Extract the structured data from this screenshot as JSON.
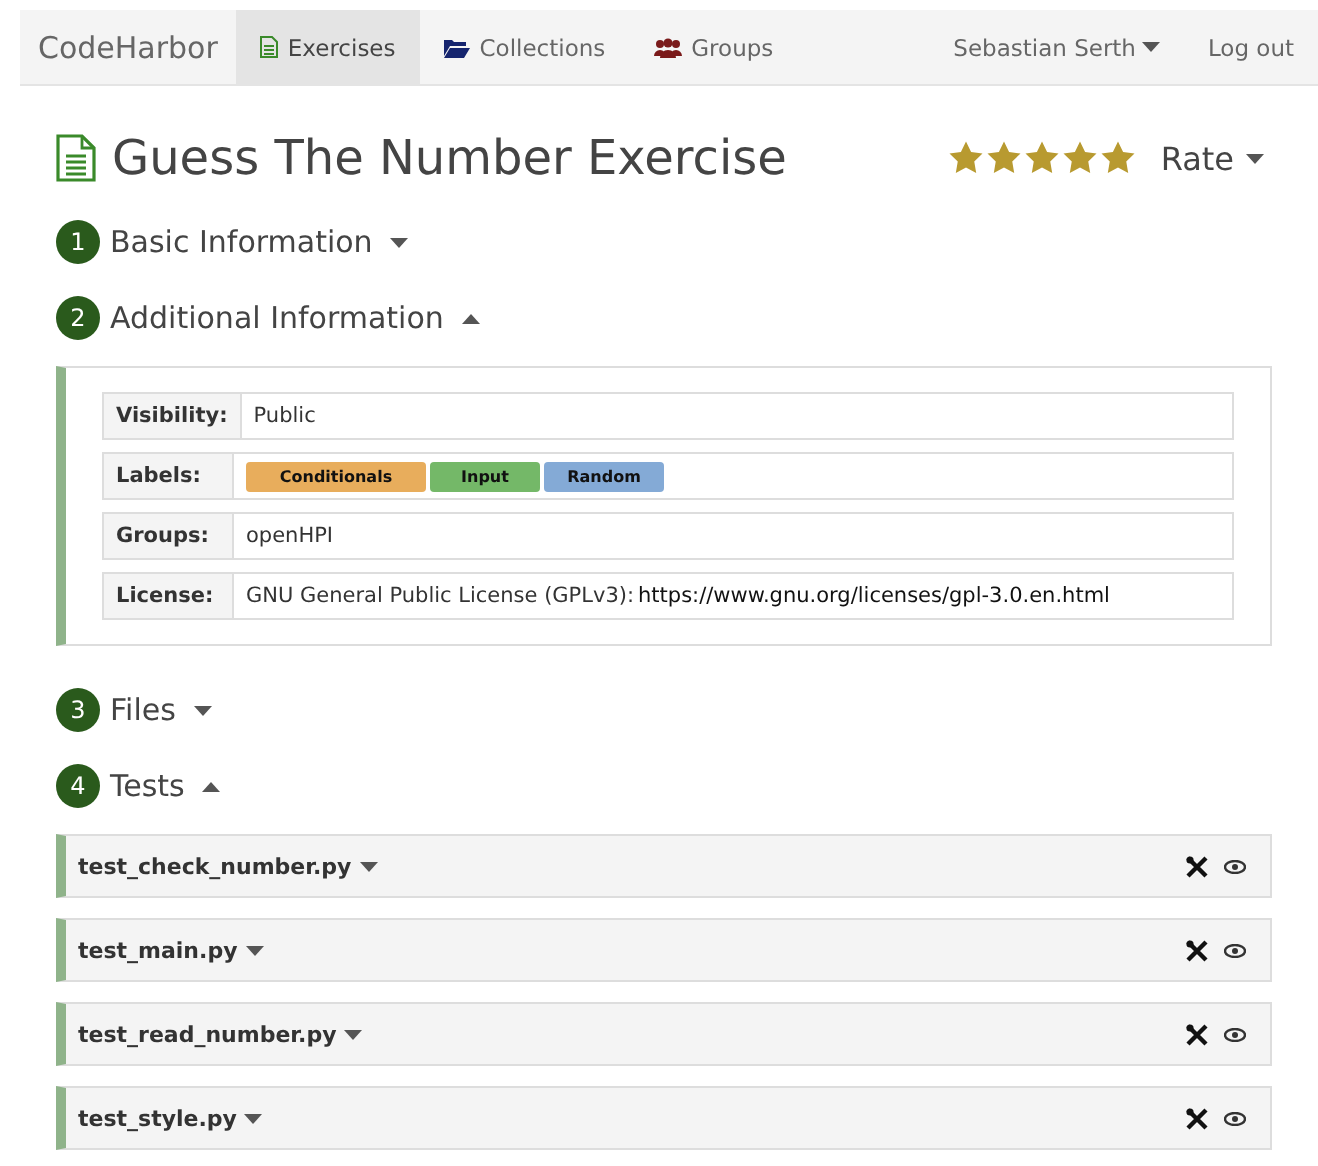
{
  "navbar": {
    "brand": "CodeHarbor",
    "items": [
      {
        "label": "Exercises",
        "selected": true
      },
      {
        "label": "Collections",
        "selected": false
      },
      {
        "label": "Groups",
        "selected": false
      }
    ],
    "user": "Sebastian Serth",
    "logout": "Log out"
  },
  "title": "Guess The Number Exercise",
  "stars": 5,
  "rate": "Rate",
  "sections": [
    {
      "number": "1",
      "title": "Basic Information",
      "expanded": false
    },
    {
      "number": "2",
      "title": "Additional Information",
      "expanded": true,
      "details": [
        {
          "label": "Visibility:",
          "value": "Public"
        },
        {
          "label": "Labels:",
          "tags": [
            {
              "text": "Conditionals",
              "color": "#e8ad5c"
            },
            {
              "text": "Input",
              "color": "#74b868"
            },
            {
              "text": "Random",
              "color": "#84aad6"
            }
          ]
        },
        {
          "label": "Groups:",
          "value": "openHPI"
        },
        {
          "label": "License:",
          "value": "GNU General Public License (GPLv3):",
          "link": "https://www.gnu.org/licenses/gpl-3.0.en.html"
        }
      ]
    },
    {
      "number": "3",
      "title": "Files",
      "expanded": false
    },
    {
      "number": "4",
      "title": "Tests",
      "expanded": true,
      "tests": [
        {
          "name": "test_check_number.py"
        },
        {
          "name": "test_main.py"
        },
        {
          "name": "test_read_number.py"
        },
        {
          "name": "test_style.py"
        }
      ]
    }
  ]
}
